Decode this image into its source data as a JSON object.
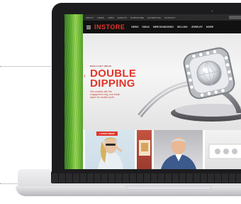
{
  "site": {
    "utility_links": [
      "ABOUT",
      "NEWS",
      "JOBS",
      "EVENTS",
      "SUBSCRIBE",
      "ADVERTISE",
      "CONTACT"
    ],
    "logo": "INSTORE",
    "nav": [
      "NEWS",
      "IDEAS",
      "MERCHANDISING",
      "SELLING",
      "JEWELRY",
      "MORE"
    ],
    "hero": {
      "eyebrow": "BRILLIANT IDEAS",
      "headline": "DOUBLE DIPPING",
      "description": "Get creative with the engagement ring, use bridal layers for double profit."
    },
    "badge": "LATEST NEWS"
  },
  "colors": {
    "accent": "#e2352a",
    "nav_bg": "#111111",
    "bezel": "#1c1c1e"
  }
}
